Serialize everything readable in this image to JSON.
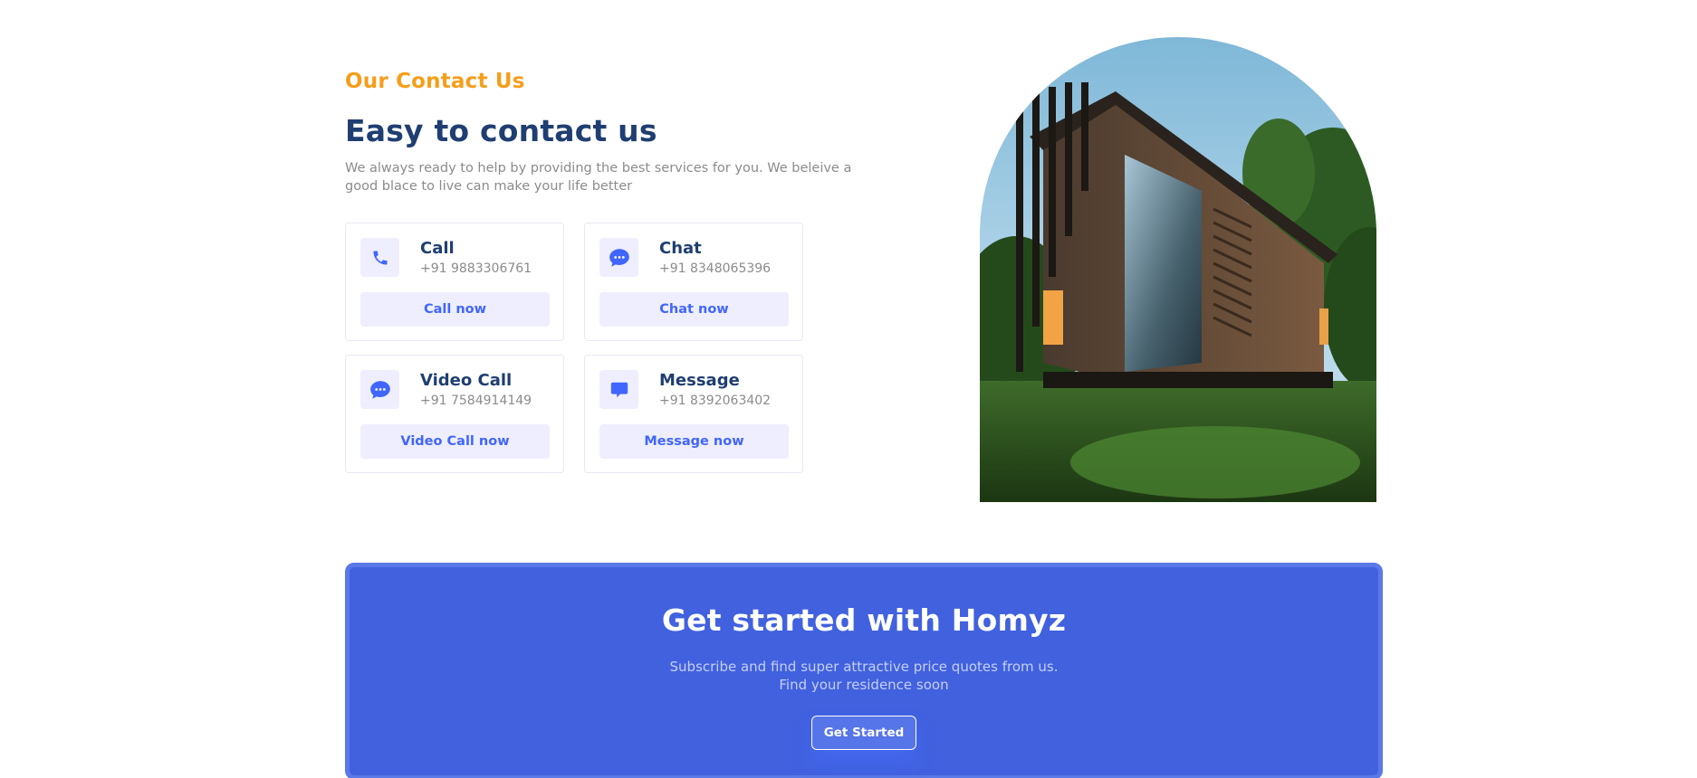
{
  "contact": {
    "eyebrow": "Our Contact Us",
    "title": "Easy to contact us",
    "description": "We always ready to help by providing the best services for you. We beleive a good blace to live can make your life better",
    "cards": [
      {
        "name": "Call",
        "phone": "+91 9883306761",
        "button": "Call now",
        "icon": "phone-icon"
      },
      {
        "name": "Chat",
        "phone": "+91 8348065396",
        "button": "Chat now",
        "icon": "chat-bubble-icon"
      },
      {
        "name": "Video Call",
        "phone": "+91 7584914149",
        "button": "Video Call now",
        "icon": "chat-bubble-icon"
      },
      {
        "name": "Message",
        "phone": "+91 8392063402",
        "button": "Message now",
        "icon": "message-icon"
      }
    ]
  },
  "get_started": {
    "title": "Get started with Homyz",
    "subtitle_line1": "Subscribe and find super attractive price quotes from us.",
    "subtitle_line2": "Find your residence soon",
    "button": "Get Started"
  },
  "colors": {
    "accent_orange": "#f59e1b",
    "heading_blue": "#1f3e72",
    "primary_blue": "#4161df",
    "icon_blue": "#4066ff",
    "soft_bg": "#eeeeff"
  }
}
